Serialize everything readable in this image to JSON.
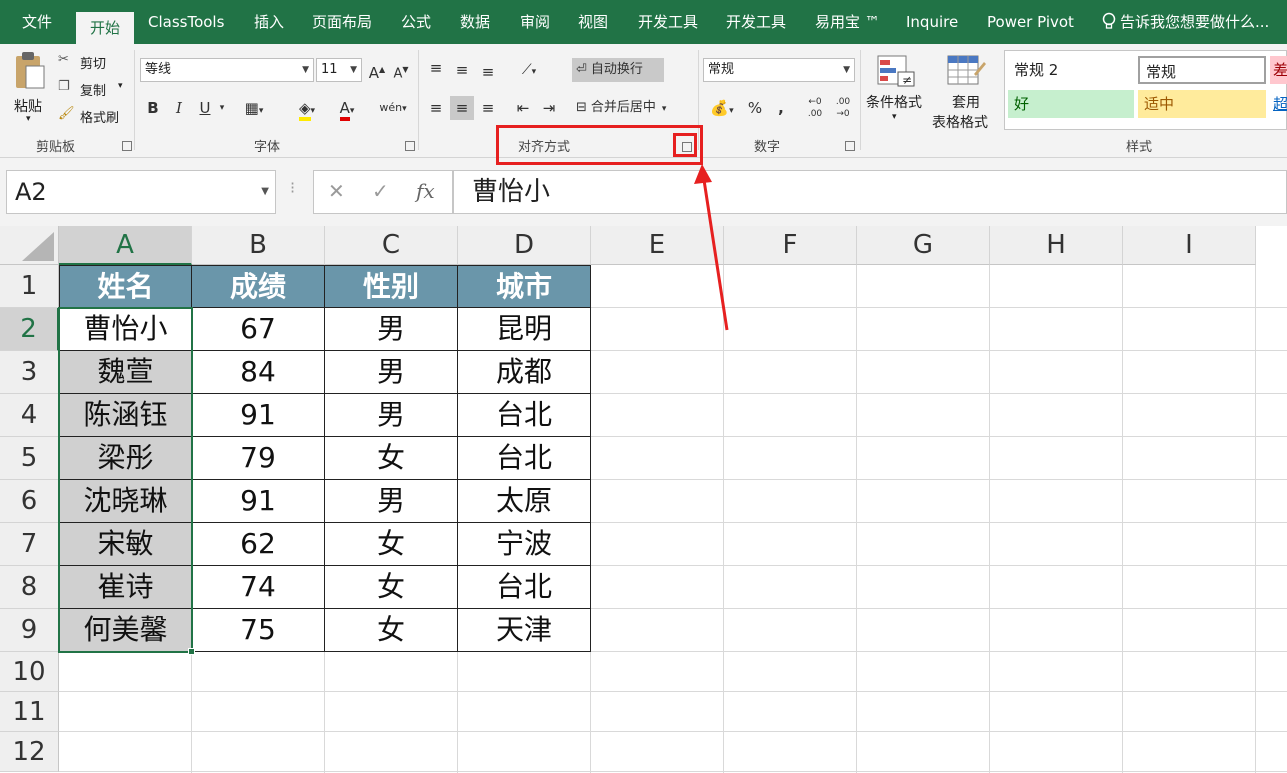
{
  "tabs": {
    "file": "文件",
    "home": "开始",
    "classtools": "ClassTools",
    "insert": "插入",
    "page_layout": "页面布局",
    "formulas": "公式",
    "data": "数据",
    "review": "审阅",
    "view": "视图",
    "developer1": "开发工具",
    "developer2": "开发工具",
    "easy": "易用宝 ™",
    "inquire": "Inquire",
    "power_pivot": "Power Pivot",
    "tell_me": "告诉我您想要做什么..."
  },
  "clipboard": {
    "paste": "粘贴",
    "cut": "剪切",
    "copy": "复制",
    "format_painter": "格式刷",
    "group_label": "剪贴板"
  },
  "font": {
    "name": "等线",
    "size": "11",
    "group_label": "字体",
    "bold": "B",
    "italic": "I",
    "underline": "U"
  },
  "alignment": {
    "wrap_text": "自动换行",
    "merge_center": "合并后居中",
    "group_label": "对齐方式"
  },
  "number": {
    "format": "常规",
    "group_label": "数字",
    "percent": "%",
    "comma": ","
  },
  "styles": {
    "conditional_formatting": "条件格式",
    "format_as_table_line1": "套用",
    "format_as_table_line2": "表格格式",
    "normal2": "常规 2",
    "normal": "常规",
    "bad": "差",
    "good": "好",
    "neutral": "适中",
    "hyperlink": "超",
    "group_label": "样式"
  },
  "formula_bar": {
    "name_box": "A2",
    "cancel": "✕",
    "enter": "✓",
    "fx": "fx",
    "content": "曹怡小"
  },
  "columns": [
    "A",
    "B",
    "C",
    "D",
    "E",
    "F",
    "G",
    "H",
    "I"
  ],
  "rows": [
    "1",
    "2",
    "3",
    "4",
    "5",
    "6",
    "7",
    "8",
    "9",
    "10",
    "11",
    "12"
  ],
  "table": {
    "headers": [
      "姓名",
      "成绩",
      "性别",
      "城市"
    ],
    "rows": [
      [
        "曹怡小",
        "67",
        "男",
        "昆明"
      ],
      [
        "魏萱",
        "84",
        "男",
        "成都"
      ],
      [
        "陈涵钰",
        "91",
        "男",
        "台北"
      ],
      [
        "梁彤",
        "79",
        "女",
        "台北"
      ],
      [
        "沈晓琳",
        "91",
        "男",
        "太原"
      ],
      [
        "宋敏",
        "62",
        "女",
        "宁波"
      ],
      [
        "崔诗",
        "74",
        "女",
        "台北"
      ],
      [
        "何美馨",
        "75",
        "女",
        "天津"
      ]
    ]
  },
  "colors": {
    "ribbon_green": "#217346",
    "header_fill": "#6a96aa",
    "selection_fill": "#d0d0d0",
    "annotation_red": "#e62020"
  }
}
